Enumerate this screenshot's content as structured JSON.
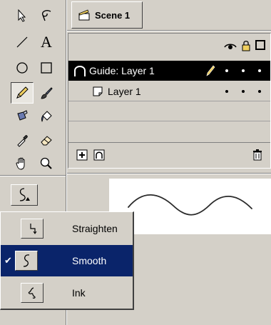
{
  "scene": {
    "tab_label": "Scene 1",
    "icon": "clapper-icon"
  },
  "toolbox": {
    "tools": [
      {
        "name": "arrow-tool",
        "icon": "arrow-icon"
      },
      {
        "name": "lasso-tool",
        "icon": "lasso-icon"
      },
      {
        "name": "line-tool",
        "icon": "line-icon"
      },
      {
        "name": "text-tool",
        "icon": "text-icon",
        "glyph": "A"
      },
      {
        "name": "oval-tool",
        "icon": "oval-icon"
      },
      {
        "name": "rectangle-tool",
        "icon": "rectangle-icon"
      },
      {
        "name": "pencil-tool",
        "icon": "pencil-icon",
        "active": true
      },
      {
        "name": "brush-tool",
        "icon": "brush-icon"
      },
      {
        "name": "ink-bottle-tool",
        "icon": "ink-bottle-icon"
      },
      {
        "name": "paint-bucket-tool",
        "icon": "paint-bucket-icon"
      },
      {
        "name": "dropper-tool",
        "icon": "dropper-icon"
      },
      {
        "name": "eraser-tool",
        "icon": "eraser-icon"
      },
      {
        "name": "hand-tool",
        "icon": "hand-icon"
      },
      {
        "name": "zoom-tool",
        "icon": "magnifier-icon"
      }
    ],
    "modifier_icon": "smooth-mode-icon"
  },
  "layers": {
    "header_icons": [
      "eye-icon",
      "lock-icon",
      "outline-icon"
    ],
    "rows": [
      {
        "label": "Guide: Layer 1",
        "selected": true,
        "icon": "guide-layer-icon",
        "edit_icon": "pencil-icon"
      },
      {
        "label": "Layer 1",
        "selected": false,
        "icon": "layer-icon"
      }
    ],
    "footer_icons": [
      "insert-layer-icon",
      "add-guide-layer-icon",
      "trash-icon"
    ]
  },
  "pencil_mode_menu": {
    "items": [
      {
        "label": "Straighten",
        "icon": "straighten-icon",
        "checked": false
      },
      {
        "label": "Smooth",
        "icon": "smooth-icon",
        "checked": true
      },
      {
        "label": "Ink",
        "icon": "ink-icon",
        "checked": false
      }
    ],
    "check_glyph": "✔"
  },
  "colors": {
    "face": "#d4d0c8",
    "selection": "#0a246a",
    "stage": "#ffffff"
  }
}
